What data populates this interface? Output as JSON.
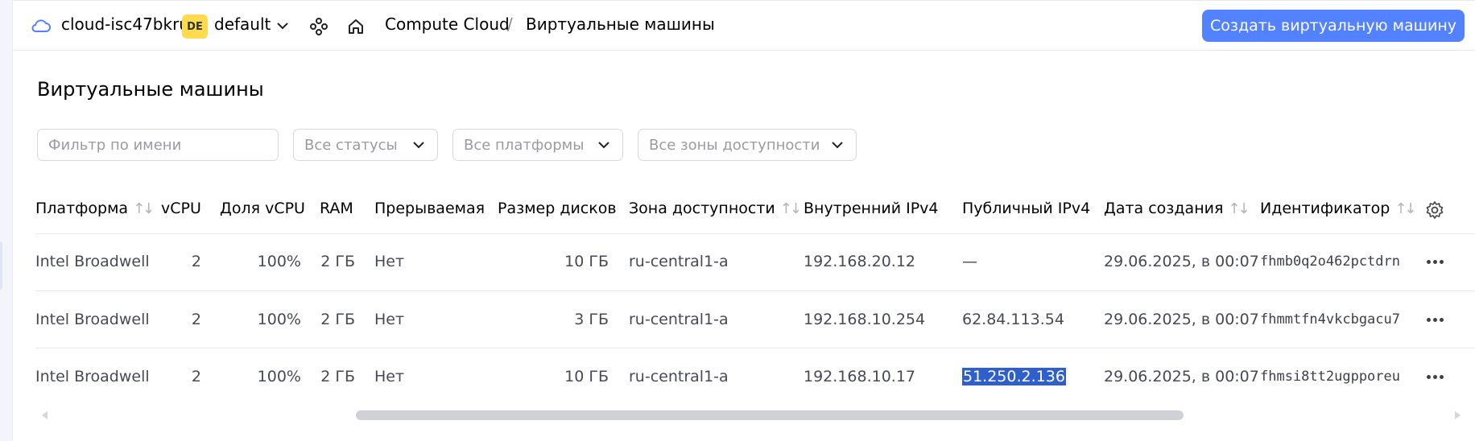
{
  "header": {
    "cloud_name": "cloud-isc47bkru",
    "folder_badge": "DE",
    "folder_name": "default",
    "breadcrumb_service": "Compute Cloud",
    "breadcrumb_separator": "/",
    "breadcrumb_current": "Виртуальные машины",
    "create_button": "Создать виртуальную машину"
  },
  "page": {
    "title": "Виртуальные машины"
  },
  "filters": {
    "name_placeholder": "Фильтр по имени",
    "status": "Все статусы",
    "platform": "Все платформы",
    "zone": "Все зоны доступности"
  },
  "table": {
    "columns": {
      "platform": "Платформа",
      "vcpu": "vCPU",
      "vcpu_share": "Доля vCPU",
      "ram": "RAM",
      "preemptible": "Прерываемая",
      "disk_size": "Размер дисков",
      "zone": "Зона доступности",
      "internal_ip": "Внутренний IPv4",
      "public_ip": "Публичный IPv4",
      "created": "Дата создания",
      "id": "Идентификатор"
    },
    "rows": [
      {
        "platform": "Intel Broadwell",
        "vcpu": "2",
        "vcpu_share": "100%",
        "ram": "2 ГБ",
        "preemptible": "Нет",
        "disk_size": "10 ГБ",
        "zone": "ru-central1-a",
        "internal_ip": "192.168.20.12",
        "public_ip": "—",
        "created": "29.06.2025, в 00:07",
        "id": "fhmb0q2o462pctdrn"
      },
      {
        "platform": "Intel Broadwell",
        "vcpu": "2",
        "vcpu_share": "100%",
        "ram": "2 ГБ",
        "preemptible": "Нет",
        "disk_size": "3 ГБ",
        "zone": "ru-central1-a",
        "internal_ip": "192.168.10.254",
        "public_ip": "62.84.113.54",
        "created": "29.06.2025, в 00:07",
        "id": "fhmmtfn4vkcbgacu7"
      },
      {
        "platform": "Intel Broadwell",
        "vcpu": "2",
        "vcpu_share": "100%",
        "ram": "2 ГБ",
        "preemptible": "Нет",
        "disk_size": "10 ГБ",
        "zone": "ru-central1-a",
        "internal_ip": "192.168.10.17",
        "public_ip": "51.250.2.136",
        "created": "29.06.2025, в 00:07",
        "id": "fhmsi8tt2ugpporeu"
      }
    ]
  },
  "colors": {
    "accent": "#5282ff",
    "badge": "#ffdb4d",
    "selection": "#2f5fca"
  },
  "icons": [
    "cloud-icon",
    "chevron-down-icon",
    "services-icon",
    "home-icon",
    "sort-icon",
    "gear-icon",
    "more-icon",
    "arrow-left-icon",
    "arrow-right-icon"
  ]
}
